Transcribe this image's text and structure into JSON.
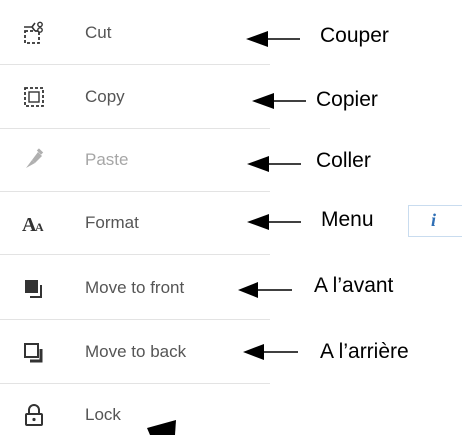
{
  "menu": {
    "items": [
      {
        "label": "Cut",
        "icon": "cut-icon",
        "enabled": true
      },
      {
        "label": "Copy",
        "icon": "copy-icon",
        "enabled": true
      },
      {
        "label": "Paste",
        "icon": "paste-icon",
        "enabled": false
      },
      {
        "label": "Format",
        "icon": "format-icon",
        "enabled": true
      },
      {
        "label": "Move to front",
        "icon": "move-to-front-icon",
        "enabled": true
      },
      {
        "label": "Move to back",
        "icon": "move-to-back-icon",
        "enabled": true
      },
      {
        "label": "Lock",
        "icon": "lock-icon",
        "enabled": true
      }
    ]
  },
  "annotations": {
    "cut": "Couper",
    "copy": "Copier",
    "paste": "Coller",
    "format": "Menu",
    "front": "A l’avant",
    "back": "A l’arrière"
  },
  "info_icon": "i",
  "colors": {
    "label": "#555555",
    "label_disabled": "#a6a6a6",
    "icon": "#333333",
    "icon_disabled": "#b0b0b0",
    "divider": "#e3e3e3",
    "info": "#2f6fb5"
  }
}
